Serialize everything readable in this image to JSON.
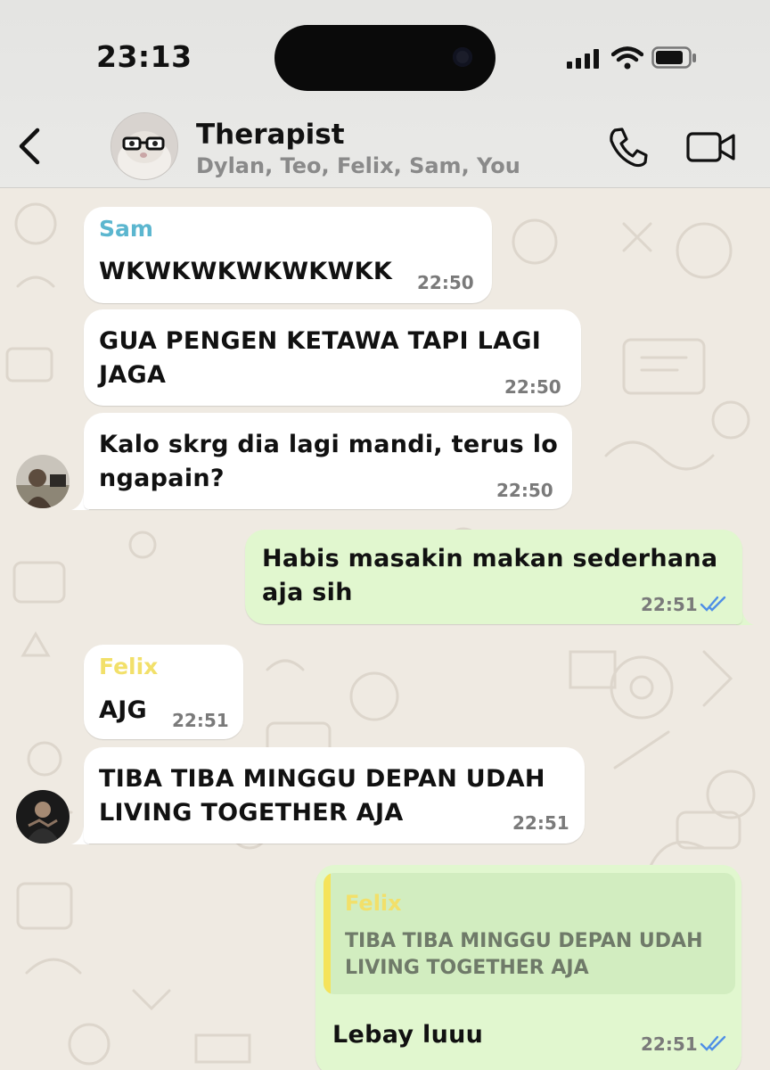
{
  "status": {
    "time": "23:13"
  },
  "header": {
    "title": "Therapist",
    "subtitle": "Dylan, Teo, Felix, Sam, You"
  },
  "colors": {
    "sam": "#5bb6cf",
    "felix": "#f2e06a",
    "outgoing": "#e1f7cf",
    "incoming": "#ffffff",
    "ticks": "#4f8fe6"
  },
  "messages": [
    {
      "sender": "Sam",
      "text": "WKWKWKWKWKWKK",
      "time": "22:50"
    },
    {
      "text_line1": "GUA PENGEN KETAWA TAPI LAGI",
      "text_line2": "JAGA",
      "time": "22:50"
    },
    {
      "text_line1": "Kalo skrg dia lagi mandi, terus lo",
      "text_line2": "ngapain?",
      "time": "22:50"
    },
    {
      "text_line1": "Habis masakin makan sederhana",
      "text_line2": "aja sih",
      "time": "22:51"
    },
    {
      "sender": "Felix",
      "text": "AJG",
      "time": "22:51"
    },
    {
      "text_line1": "TIBA TIBA MINGGU DEPAN UDAH",
      "text_line2": "LIVING TOGETHER AJA",
      "time": "22:51"
    },
    {
      "quote_sender": "Felix",
      "quote_line1": "TIBA TIBA MINGGU DEPAN UDAH",
      "quote_line2": "LIVING TOGETHER AJA",
      "text": "Lebay luuu",
      "time": "22:51"
    }
  ]
}
